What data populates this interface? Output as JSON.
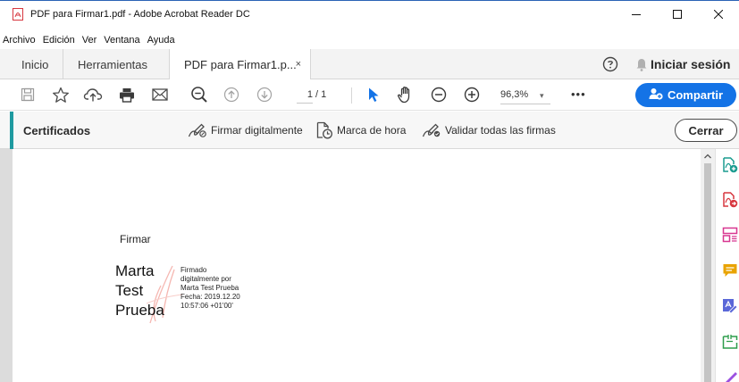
{
  "window": {
    "title": "PDF para Firmar1.pdf - Adobe Acrobat Reader DC",
    "controls": [
      "minimize-icon",
      "maximize-icon",
      "close-icon"
    ]
  },
  "menu": [
    "Archivo",
    "Edición",
    "Ver",
    "Ventana",
    "Ayuda"
  ],
  "tabs": {
    "home": "Inicio",
    "tools": "Herramientas",
    "document": "PDF para Firmar1.p...",
    "close_glyph": "×"
  },
  "header": {
    "signin": "Iniciar sesión",
    "icons": [
      "help-icon",
      "bell-icon"
    ]
  },
  "toolbar": {
    "icons": [
      "save-icon",
      "star-icon",
      "upload-icon",
      "print-icon",
      "email-icon",
      "search-zoom-icon",
      "page-up-icon",
      "page-down-icon",
      "select-arrow-icon",
      "hand-icon",
      "zoom-out-icon",
      "zoom-in-icon"
    ],
    "page_current": "1",
    "page_total": "/ 1",
    "zoom": "96,3%",
    "zoom_caret": "▾",
    "more": "•••",
    "share": "Compartir"
  },
  "certificates": {
    "title": "Certificados",
    "sign_digitally": "Firmar digitalmente",
    "timestamp": "Marca de hora",
    "validate_all": "Validar todas las firmas",
    "close": "Cerrar"
  },
  "document": {
    "field_heading": "Firmar",
    "signer_lines": [
      "Marta",
      "Test",
      "Prueba"
    ],
    "details": [
      "Firmado",
      "digitalmente por",
      "Marta Test Prueba",
      "Fecha: 2019.12.20",
      "10:57:06 +01'00'"
    ]
  },
  "rail_icons": [
    "create-pdf-icon",
    "export-pdf-icon",
    "organize-pages-icon",
    "comment-icon",
    "edit-pdf-icon",
    "compress-icon",
    "fill-sign-icon"
  ],
  "colors": {
    "accent_blue": "#1473e6",
    "cert_accent": "#1f9aa0",
    "pdf_red": "#d7373f"
  }
}
